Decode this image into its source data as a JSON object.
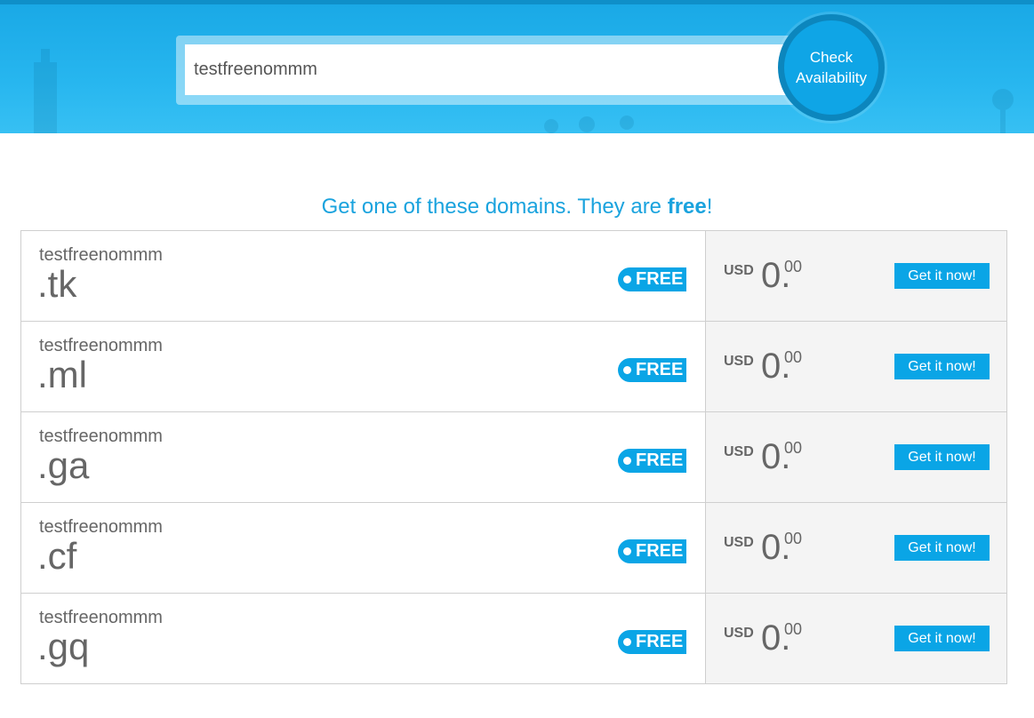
{
  "search": {
    "value": "testfreenommm",
    "button_label": "Check Availability"
  },
  "heading": {
    "text_before": "Get one of these domains. They are ",
    "text_bold": "free",
    "text_after": "!"
  },
  "domains": [
    {
      "name": "testfreenommm",
      "tld": ".tk",
      "badge": "FREE",
      "currency": "USD",
      "price_int": "0.",
      "price_dec": "00",
      "action": "Get it now!"
    },
    {
      "name": "testfreenommm",
      "tld": ".ml",
      "badge": "FREE",
      "currency": "USD",
      "price_int": "0.",
      "price_dec": "00",
      "action": "Get it now!"
    },
    {
      "name": "testfreenommm",
      "tld": ".ga",
      "badge": "FREE",
      "currency": "USD",
      "price_int": "0.",
      "price_dec": "00",
      "action": "Get it now!"
    },
    {
      "name": "testfreenommm",
      "tld": ".cf",
      "badge": "FREE",
      "currency": "USD",
      "price_int": "0.",
      "price_dec": "00",
      "action": "Get it now!"
    },
    {
      "name": "testfreenommm",
      "tld": ".gq",
      "badge": "FREE",
      "currency": "USD",
      "price_int": "0.",
      "price_dec": "00",
      "action": "Get it now!"
    }
  ],
  "colors": {
    "accent": "#0aa5e6",
    "banner": "#27b6ef",
    "text": "#666666"
  }
}
